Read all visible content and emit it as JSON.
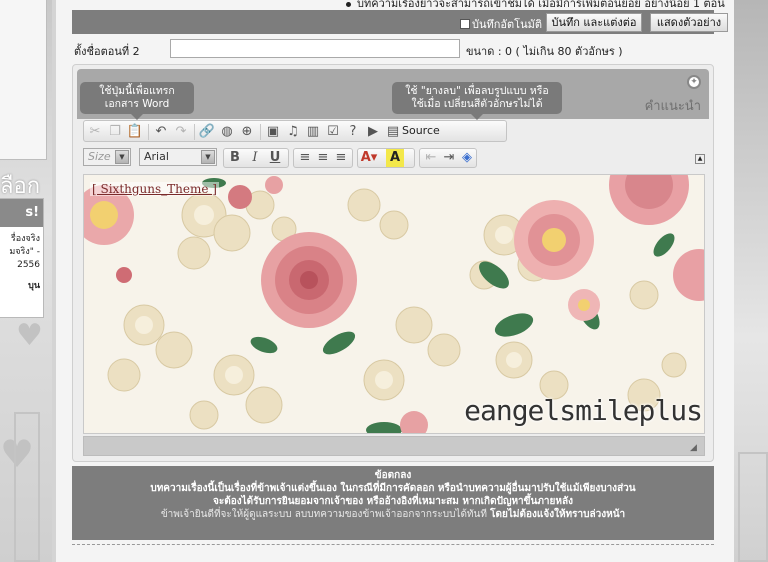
{
  "top_note": "บทความเรื่องยาวจะสามารถเข้าชมได้ เมื่อมีการเพิ่มตอนย่อย อย่างน้อย 1 ตอน",
  "toolbar": {
    "autosave_label": "บันทึกอัตโนมัติ",
    "save_label": "บันทึก และแต่งต่อ",
    "preview_label": "แสดงตัวอย่าง"
  },
  "topic": {
    "label": "ตั้งชื่อตอนที่ 2",
    "value": "",
    "size_label": "ขนาด : 0 ( ไม่เกิน 80 ตัวอักษร )"
  },
  "editor": {
    "hint_label": "คำแนะนำ",
    "tooltip_word": "ใช้ปุ่มนี้เพื่อแทรกเอกสาร Word",
    "tooltip_eraser": "ใช้ \"ยางลบ\" เพื่อลบรูปแบบ หรือใช้เมื่อ เปลี่ยนสีตัวอักษรไม่ได้",
    "source_label": "Source",
    "size_placeholder": "Size",
    "font_value": "Arial",
    "content_link": "[ Sixthguns_Theme ]",
    "watermark": "eangelsmileplus"
  },
  "rules": {
    "title": "ข้อตกลง",
    "line1": "บทความเรื่องนี้เป็นเรื่องที่ข้าพเจ้าแต่งขึ้นเอง ในกรณีที่มีการคัดลอก หรือนำบทความผู้อื่นมาปรับใช้แม้เพียงบางส่วน",
    "line2": "จะต้องได้รับการยินยอมจากเจ้าของ หรืออ้างอิงที่เหมาะสม หากเกิดปัญหาขึ้นภายหลัง",
    "line3_normal": "ข้าพเจ้ายินดีที่จะให้ผู้ดูแลระบบ ลบบทความของข้าพเจ้าออกจากระบบได้ทันที",
    "line3_bold": "โดยไม่ต้องแจ้งให้ทราบล่วงหน้า"
  },
  "side": {
    "heading": "ลือก",
    "box_head": "s!",
    "box_line1": "รื่องจริง",
    "box_line2": "มจริง\" -",
    "box_line3": "2556",
    "box_line4": "บุน"
  },
  "colors": {
    "bar_gray": "#7d7d7d",
    "editor_gray": "#a8a8a8",
    "rose": "#e8a0a4",
    "leaf": "#3f7a4e",
    "cream": "#efe6cf"
  }
}
